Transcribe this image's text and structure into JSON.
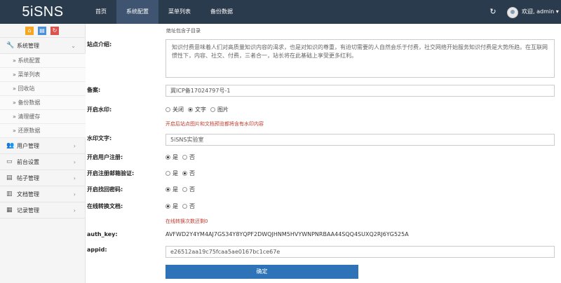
{
  "app": {
    "logo": "5iSNS"
  },
  "nav": [
    {
      "label": "首页"
    },
    {
      "label": "系统配置"
    },
    {
      "label": "菜单列表"
    },
    {
      "label": "备份数据"
    }
  ],
  "user": {
    "label": "欢迎, admin ▾"
  },
  "sidebar": {
    "shortcut_icons": [
      "home-icon",
      "document-icon",
      "refresh-icon"
    ],
    "system": {
      "label": "系统管理",
      "items": [
        "» 系统配置",
        "» 菜单列表",
        "» 回收站",
        "» 备份数据",
        "» 清理缓存",
        "» 还原数据"
      ]
    },
    "groups": [
      {
        "label": "用户管理",
        "icon": "users-icon"
      },
      {
        "label": "前台设置",
        "icon": "monitor-icon"
      },
      {
        "label": "帖子管理",
        "icon": "file-icon"
      },
      {
        "label": "文档管理",
        "icon": "book-icon"
      },
      {
        "label": "记录管理",
        "icon": "chart-icon"
      }
    ]
  },
  "form": {
    "breadcrumb": "绝址包含子目录",
    "intro": {
      "label": "站点介绍:",
      "value": "知识付费意味着人们对高质量知识内容的渴求，也是对知识的尊重，有迫切需要的人自然会乐于付费，社交网络开始服务知识付费是大势所趋。在互联网惯性下，内容、社交、付费，三者合一，站长将在此基础上享受更多红利。"
    },
    "icp": {
      "label": "备案:",
      "value": "冀ICP备17024797号-1"
    },
    "watermark": {
      "label": "开启水印:",
      "options": [
        "关闭",
        "文字",
        "图片"
      ],
      "selected": "文字",
      "hint": "开启后站点图片和文档预览都将含有水印内容"
    },
    "watermark_text": {
      "label": "水印文字:",
      "value": "5iSNS实验室"
    },
    "register": {
      "label": "开启用户注册:",
      "yes": "是",
      "no": "否",
      "selected": "是"
    },
    "email_verify": {
      "label": "开启注册邮箱验证:",
      "yes": "是",
      "no": "否",
      "selected": "否"
    },
    "find_password": {
      "label": "开启找回密码:",
      "yes": "是",
      "no": "否",
      "selected": "是"
    },
    "online_convert": {
      "label": "在线转换文档:",
      "yes": "是",
      "no": "否",
      "selected": "是",
      "hint": "在线转换次数还剩0"
    },
    "auth_key": {
      "label": "auth_key:",
      "value": "AVFWD2Y4YM4AJ7GS34Y8YQPF2DWQJHNM5HVYWNPNRBAA44SQQ4SUXQ2RJ6YG525A"
    },
    "appid": {
      "label": "appid:",
      "value": "e26512aa19c75fcaa5ae0167bc1ce67e"
    },
    "submit_label": "确定"
  }
}
